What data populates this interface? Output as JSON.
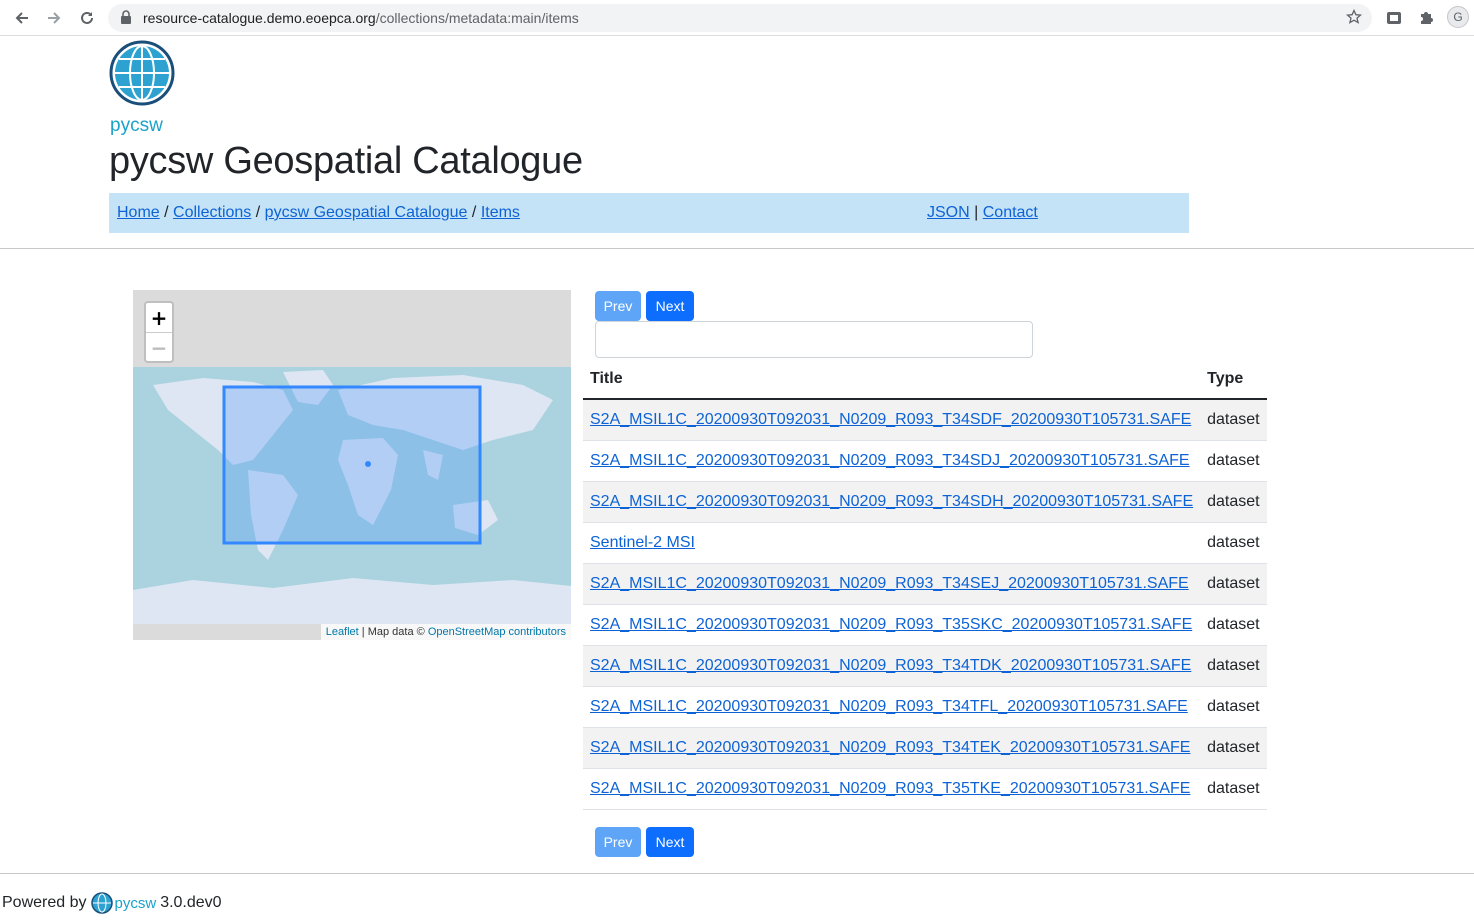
{
  "browser": {
    "url_host": "resource-catalogue.demo.eoepca.org",
    "url_path": "/collections/metadata:main/items",
    "profile_initial": "G"
  },
  "logo": {
    "text": "pycsw"
  },
  "site_title": "pycsw Geospatial Catalogue",
  "breadcrumb": {
    "home": "Home",
    "collections": "Collections",
    "catalogue": "pycsw Geospatial Catalogue",
    "items": "Items",
    "separator": "/"
  },
  "links": {
    "json": "JSON",
    "contact": "Contact",
    "separator": "|"
  },
  "map": {
    "zoom_in": "+",
    "zoom_out": "−",
    "attribution": {
      "leaflet": "Leaflet",
      "separator": "|",
      "map_data": "Map data ©",
      "osm": "OpenStreetMap contributors"
    }
  },
  "pagination": {
    "prev": "Prev",
    "next": "Next"
  },
  "search": {
    "value": "",
    "placeholder": ""
  },
  "table": {
    "headers": {
      "title": "Title",
      "type": "Type"
    },
    "rows": [
      {
        "title": "S2A_MSIL1C_20200930T092031_N0209_R093_T34SDF_20200930T105731.SAFE",
        "type": "dataset"
      },
      {
        "title": "S2A_MSIL1C_20200930T092031_N0209_R093_T34SDJ_20200930T105731.SAFE",
        "type": "dataset"
      },
      {
        "title": "S2A_MSIL1C_20200930T092031_N0209_R093_T34SDH_20200930T105731.SAFE",
        "type": "dataset"
      },
      {
        "title": "Sentinel-2 MSI",
        "type": "dataset"
      },
      {
        "title": "S2A_MSIL1C_20200930T092031_N0209_R093_T34SEJ_20200930T105731.SAFE",
        "type": "dataset"
      },
      {
        "title": "S2A_MSIL1C_20200930T092031_N0209_R093_T35SKC_20200930T105731.SAFE",
        "type": "dataset"
      },
      {
        "title": "S2A_MSIL1C_20200930T092031_N0209_R093_T34TDK_20200930T105731.SAFE",
        "type": "dataset"
      },
      {
        "title": "S2A_MSIL1C_20200930T092031_N0209_R093_T34TFL_20200930T105731.SAFE",
        "type": "dataset"
      },
      {
        "title": "S2A_MSIL1C_20200930T092031_N0209_R093_T34TEK_20200930T105731.SAFE",
        "type": "dataset"
      },
      {
        "title": "S2A_MSIL1C_20200930T092031_N0209_R093_T35TKE_20200930T105731.SAFE",
        "type": "dataset"
      }
    ]
  },
  "footer": {
    "powered_by": "Powered by",
    "brand": "pycsw",
    "version": "3.0.dev0"
  },
  "colors": {
    "link": "#0d63d6",
    "breadcrumb_bg": "#c5e3f6",
    "button": "#0d6efd",
    "button_disabled": "#5ea5f8",
    "ocean": "#aad3df",
    "bbox": "#3388ff"
  }
}
